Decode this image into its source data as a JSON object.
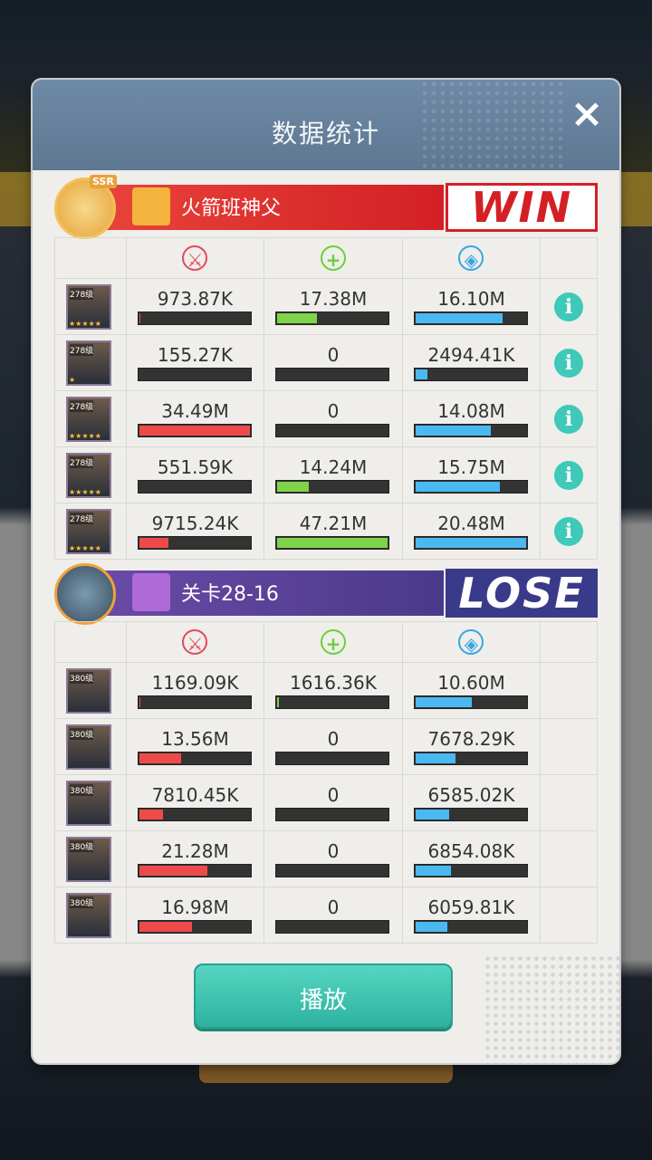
{
  "dialog": {
    "title": "数据统计",
    "close_icon": "×"
  },
  "headers": {
    "damage_icon": "⚔",
    "heal_icon": "+",
    "shield_icon": "◈"
  },
  "team_win": {
    "name": "火箭班神父",
    "result": "WIN",
    "badge": "SSR",
    "heroes": [
      {
        "level": "278级",
        "stars": "★★★★★",
        "damage": "973.87K",
        "damage_pct": 0.02,
        "heal": "17.38M",
        "heal_pct": 0.37,
        "shield": "16.10M",
        "shield_pct": 0.79,
        "info": "i"
      },
      {
        "level": "278级",
        "stars": "★",
        "damage": "155.27K",
        "damage_pct": 0.0,
        "heal": "0",
        "heal_pct": 0,
        "shield": "2494.41K",
        "shield_pct": 0.12,
        "info": "i"
      },
      {
        "level": "278级",
        "stars": "★★★★★",
        "damage": "34.49M",
        "damage_pct": 1.0,
        "heal": "0",
        "heal_pct": 0,
        "shield": "14.08M",
        "shield_pct": 0.69,
        "info": "i"
      },
      {
        "level": "278级",
        "stars": "★★★★★",
        "damage": "551.59K",
        "damage_pct": 0.01,
        "heal": "14.24M",
        "heal_pct": 0.3,
        "shield": "15.75M",
        "shield_pct": 0.77,
        "info": "i"
      },
      {
        "level": "278级",
        "stars": "★★★★★",
        "damage": "9715.24K",
        "damage_pct": 0.28,
        "heal": "47.21M",
        "heal_pct": 1.0,
        "shield": "20.48M",
        "shield_pct": 1.0,
        "info": "i"
      }
    ]
  },
  "team_lose": {
    "name": "关卡28-16",
    "result": "LOSE",
    "heroes": [
      {
        "level": "380级",
        "damage": "1169.09K",
        "damage_pct": 0.03,
        "heal": "1616.36K",
        "heal_pct": 0.03,
        "shield": "10.60M",
        "shield_pct": 0.52
      },
      {
        "level": "380级",
        "damage": "13.56M",
        "damage_pct": 0.39,
        "heal": "0",
        "heal_pct": 0,
        "shield": "7678.29K",
        "shield_pct": 0.37
      },
      {
        "level": "380级",
        "damage": "7810.45K",
        "damage_pct": 0.23,
        "heal": "0",
        "heal_pct": 0,
        "shield": "6585.02K",
        "shield_pct": 0.32
      },
      {
        "level": "380级",
        "damage": "21.28M",
        "damage_pct": 0.62,
        "heal": "0",
        "heal_pct": 0,
        "shield": "6854.08K",
        "shield_pct": 0.33
      },
      {
        "level": "380级",
        "damage": "16.98M",
        "damage_pct": 0.49,
        "heal": "0",
        "heal_pct": 0,
        "shield": "6059.81K",
        "shield_pct": 0.3
      }
    ]
  },
  "play_button": {
    "label": "播放"
  },
  "colors": {
    "damage": "#ef4a4a",
    "heal": "#7fd34a",
    "shield": "#4ab9f2",
    "win": "#d42025",
    "lose": "#3a3a8a"
  }
}
